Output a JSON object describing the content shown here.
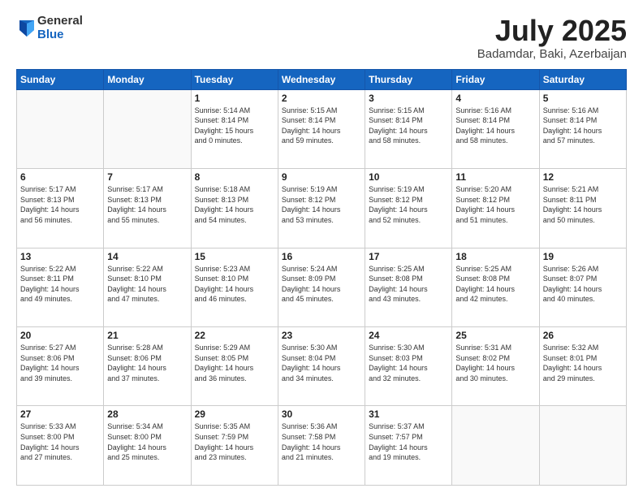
{
  "header": {
    "logo_general": "General",
    "logo_blue": "Blue",
    "month": "July 2025",
    "location": "Badamdar, Baki, Azerbaijan"
  },
  "weekdays": [
    "Sunday",
    "Monday",
    "Tuesday",
    "Wednesday",
    "Thursday",
    "Friday",
    "Saturday"
  ],
  "weeks": [
    [
      {
        "day": "",
        "info": ""
      },
      {
        "day": "",
        "info": ""
      },
      {
        "day": "1",
        "info": "Sunrise: 5:14 AM\nSunset: 8:14 PM\nDaylight: 15 hours\nand 0 minutes."
      },
      {
        "day": "2",
        "info": "Sunrise: 5:15 AM\nSunset: 8:14 PM\nDaylight: 14 hours\nand 59 minutes."
      },
      {
        "day": "3",
        "info": "Sunrise: 5:15 AM\nSunset: 8:14 PM\nDaylight: 14 hours\nand 58 minutes."
      },
      {
        "day": "4",
        "info": "Sunrise: 5:16 AM\nSunset: 8:14 PM\nDaylight: 14 hours\nand 58 minutes."
      },
      {
        "day": "5",
        "info": "Sunrise: 5:16 AM\nSunset: 8:14 PM\nDaylight: 14 hours\nand 57 minutes."
      }
    ],
    [
      {
        "day": "6",
        "info": "Sunrise: 5:17 AM\nSunset: 8:13 PM\nDaylight: 14 hours\nand 56 minutes."
      },
      {
        "day": "7",
        "info": "Sunrise: 5:17 AM\nSunset: 8:13 PM\nDaylight: 14 hours\nand 55 minutes."
      },
      {
        "day": "8",
        "info": "Sunrise: 5:18 AM\nSunset: 8:13 PM\nDaylight: 14 hours\nand 54 minutes."
      },
      {
        "day": "9",
        "info": "Sunrise: 5:19 AM\nSunset: 8:12 PM\nDaylight: 14 hours\nand 53 minutes."
      },
      {
        "day": "10",
        "info": "Sunrise: 5:19 AM\nSunset: 8:12 PM\nDaylight: 14 hours\nand 52 minutes."
      },
      {
        "day": "11",
        "info": "Sunrise: 5:20 AM\nSunset: 8:12 PM\nDaylight: 14 hours\nand 51 minutes."
      },
      {
        "day": "12",
        "info": "Sunrise: 5:21 AM\nSunset: 8:11 PM\nDaylight: 14 hours\nand 50 minutes."
      }
    ],
    [
      {
        "day": "13",
        "info": "Sunrise: 5:22 AM\nSunset: 8:11 PM\nDaylight: 14 hours\nand 49 minutes."
      },
      {
        "day": "14",
        "info": "Sunrise: 5:22 AM\nSunset: 8:10 PM\nDaylight: 14 hours\nand 47 minutes."
      },
      {
        "day": "15",
        "info": "Sunrise: 5:23 AM\nSunset: 8:10 PM\nDaylight: 14 hours\nand 46 minutes."
      },
      {
        "day": "16",
        "info": "Sunrise: 5:24 AM\nSunset: 8:09 PM\nDaylight: 14 hours\nand 45 minutes."
      },
      {
        "day": "17",
        "info": "Sunrise: 5:25 AM\nSunset: 8:08 PM\nDaylight: 14 hours\nand 43 minutes."
      },
      {
        "day": "18",
        "info": "Sunrise: 5:25 AM\nSunset: 8:08 PM\nDaylight: 14 hours\nand 42 minutes."
      },
      {
        "day": "19",
        "info": "Sunrise: 5:26 AM\nSunset: 8:07 PM\nDaylight: 14 hours\nand 40 minutes."
      }
    ],
    [
      {
        "day": "20",
        "info": "Sunrise: 5:27 AM\nSunset: 8:06 PM\nDaylight: 14 hours\nand 39 minutes."
      },
      {
        "day": "21",
        "info": "Sunrise: 5:28 AM\nSunset: 8:06 PM\nDaylight: 14 hours\nand 37 minutes."
      },
      {
        "day": "22",
        "info": "Sunrise: 5:29 AM\nSunset: 8:05 PM\nDaylight: 14 hours\nand 36 minutes."
      },
      {
        "day": "23",
        "info": "Sunrise: 5:30 AM\nSunset: 8:04 PM\nDaylight: 14 hours\nand 34 minutes."
      },
      {
        "day": "24",
        "info": "Sunrise: 5:30 AM\nSunset: 8:03 PM\nDaylight: 14 hours\nand 32 minutes."
      },
      {
        "day": "25",
        "info": "Sunrise: 5:31 AM\nSunset: 8:02 PM\nDaylight: 14 hours\nand 30 minutes."
      },
      {
        "day": "26",
        "info": "Sunrise: 5:32 AM\nSunset: 8:01 PM\nDaylight: 14 hours\nand 29 minutes."
      }
    ],
    [
      {
        "day": "27",
        "info": "Sunrise: 5:33 AM\nSunset: 8:00 PM\nDaylight: 14 hours\nand 27 minutes."
      },
      {
        "day": "28",
        "info": "Sunrise: 5:34 AM\nSunset: 8:00 PM\nDaylight: 14 hours\nand 25 minutes."
      },
      {
        "day": "29",
        "info": "Sunrise: 5:35 AM\nSunset: 7:59 PM\nDaylight: 14 hours\nand 23 minutes."
      },
      {
        "day": "30",
        "info": "Sunrise: 5:36 AM\nSunset: 7:58 PM\nDaylight: 14 hours\nand 21 minutes."
      },
      {
        "day": "31",
        "info": "Sunrise: 5:37 AM\nSunset: 7:57 PM\nDaylight: 14 hours\nand 19 minutes."
      },
      {
        "day": "",
        "info": ""
      },
      {
        "day": "",
        "info": ""
      }
    ]
  ]
}
